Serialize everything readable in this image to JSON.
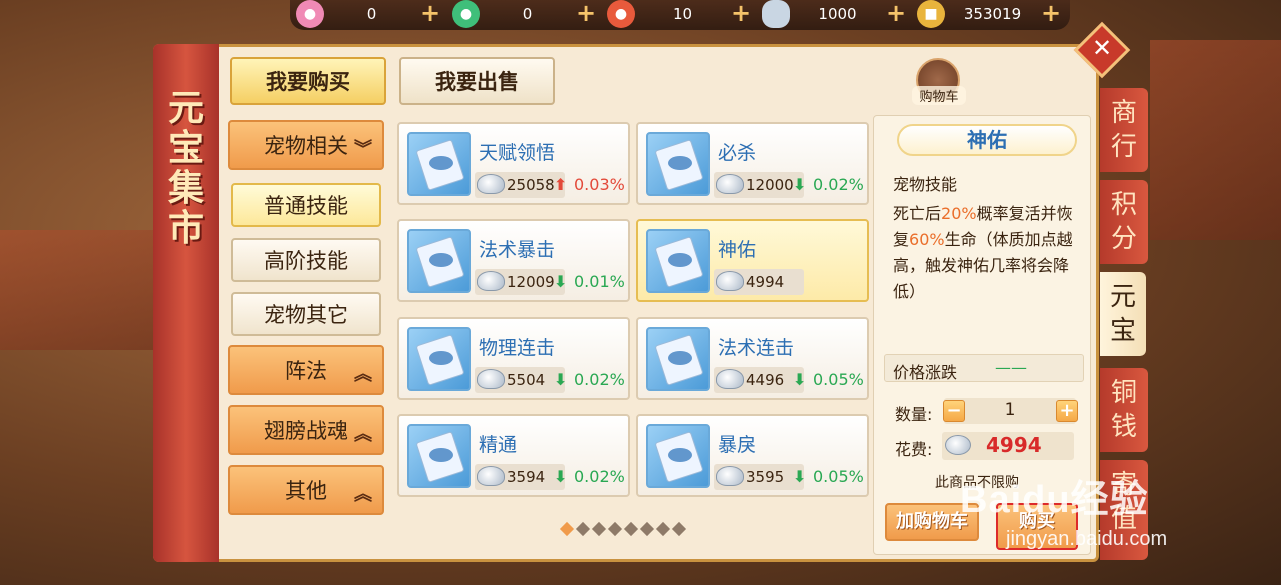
{
  "currencies": [
    {
      "icon": "pink-pet-coin-icon",
      "value": "0",
      "color": "#f08ab5"
    },
    {
      "icon": "green-pet-coin-icon",
      "value": "0",
      "color": "#3fbf7a"
    },
    {
      "icon": "red-pet-coin-icon",
      "value": "10",
      "color": "#e85a3c"
    },
    {
      "icon": "silver-ingot-icon",
      "value": "1000",
      "color": "#c9d6e3"
    },
    {
      "icon": "gold-coin-icon",
      "value": "353019",
      "color": "#e9b43c"
    }
  ],
  "banner_title": "元宝集市",
  "tabs": {
    "buy": "我要购买",
    "sell": "我要出售"
  },
  "categories": {
    "pet": "宠物相关",
    "normal_skill": "普通技能",
    "advanced_skill": "高阶技能",
    "pet_other": "宠物其它",
    "formation": "阵法",
    "wings": "翅膀战魂",
    "other": "其他"
  },
  "items": [
    {
      "name": "天赋领悟",
      "price": "25058",
      "trend": "up",
      "pct": "0.03%"
    },
    {
      "name": "必杀",
      "price": "12000",
      "trend": "down",
      "pct": "0.02%"
    },
    {
      "name": "法术暴击",
      "price": "12009",
      "trend": "down",
      "pct": "0.01%"
    },
    {
      "name": "神佑",
      "price": "4994",
      "trend": "none",
      "pct": ""
    },
    {
      "name": "物理连击",
      "price": "5504",
      "trend": "down",
      "pct": "0.02%"
    },
    {
      "name": "法术连击",
      "price": "4496",
      "trend": "down",
      "pct": "0.05%"
    },
    {
      "name": "精通",
      "price": "3594",
      "trend": "down",
      "pct": "0.02%"
    },
    {
      "name": "暴戾",
      "price": "3595",
      "trend": "down",
      "pct": "0.05%"
    }
  ],
  "cart_label": "购物车",
  "detail": {
    "title": "神佑",
    "type": "宠物技能",
    "desc_1": "死亡后",
    "desc_hl1": "20%",
    "desc_2": "概率复活并恢复",
    "desc_hl2": "60%",
    "desc_3": "生命（体质加点越高，触发神佑几率将会降低）",
    "trend_label": "价格涨跌",
    "trend_value": "——",
    "qty_label": "数量:",
    "qty_value": "1",
    "cost_label": "花费:",
    "cost_value": "4994",
    "limit_note": "此商品不限购",
    "add_cart": "加购物车",
    "buy": "购买"
  },
  "side_tabs": [
    "商行",
    "积分",
    "元宝",
    "铜钱",
    "寄值"
  ],
  "page": {
    "count": 8,
    "current": 1
  },
  "watermark": {
    "main": "Baidu经验",
    "sub": "jingyan.baidu.com"
  }
}
